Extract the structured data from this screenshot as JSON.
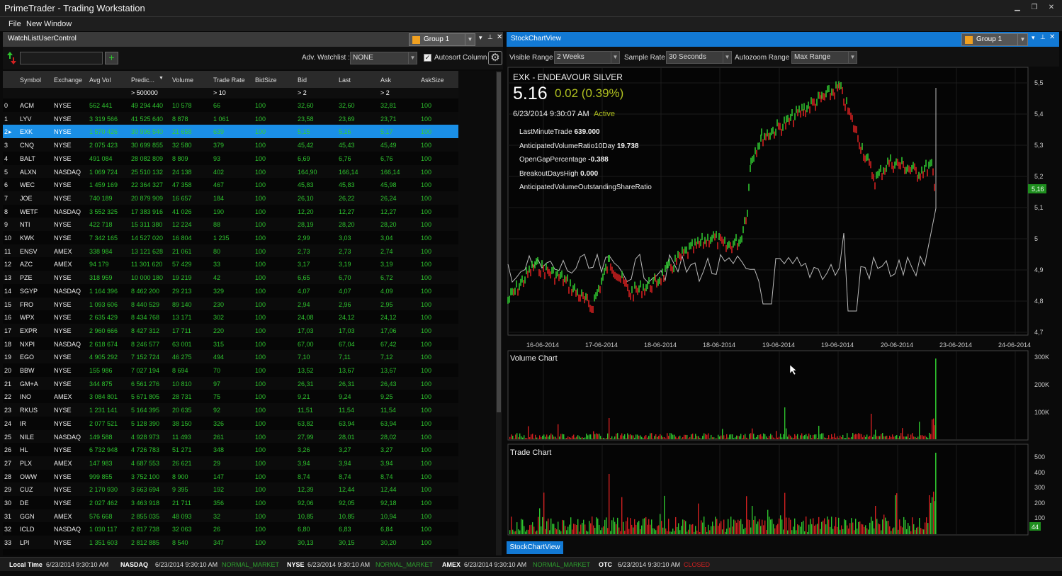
{
  "window": {
    "title": "PrimeTrader - Trading Workstation"
  },
  "menu": {
    "file": "File",
    "new_window": "New Window"
  },
  "watchlist": {
    "panel_title": "WatchListUserControl",
    "group": "Group 1",
    "adv_label": "Adv. Watchlist :",
    "adv_value": "NONE",
    "autosort_label": "Autosort Column",
    "columns": [
      "Symbol",
      "Exchange",
      "Avg Vol",
      "Predic...",
      "Volume",
      "Trade Rate",
      "BidSize",
      "Bid",
      "Last",
      "Ask",
      "AskSize"
    ],
    "filters": {
      "predic": "> 500000",
      "trade_rate": "> 10",
      "bid": "> 2",
      "ask": "> 2"
    },
    "rows": [
      [
        "0",
        "ACM",
        "NYSE",
        "562 441",
        "49 294 440",
        "10 578",
        "66",
        "100",
        "32,60",
        "32,60",
        "32,81",
        "100"
      ],
      [
        "1",
        "LYV",
        "NYSE",
        "3 319 566",
        "41 525 640",
        "8 878",
        "1 061",
        "100",
        "23,58",
        "23,69",
        "23,71",
        "100"
      ],
      [
        "2",
        "EXK",
        "NYSE",
        "1 570 426",
        "30 996 540",
        "21 658",
        "639",
        "100",
        "5,15",
        "5,16",
        "5,17",
        "100"
      ],
      [
        "3",
        "CNQ",
        "NYSE",
        "2 075 423",
        "30 699 855",
        "32 580",
        "379",
        "100",
        "45,42",
        "45,43",
        "45,49",
        "100"
      ],
      [
        "4",
        "BALT",
        "NYSE",
        "491 084",
        "28 082 809",
        "8 809",
        "93",
        "100",
        "6,69",
        "6,76",
        "6,76",
        "100"
      ],
      [
        "5",
        "ALXN",
        "NASDAQ",
        "1 069 724",
        "25 510 132",
        "24 138",
        "402",
        "100",
        "164,90",
        "166,14",
        "166,14",
        "100"
      ],
      [
        "6",
        "WEC",
        "NYSE",
        "1 459 169",
        "22 364 327",
        "47 358",
        "467",
        "100",
        "45,83",
        "45,83",
        "45,98",
        "100"
      ],
      [
        "7",
        "JOE",
        "NYSE",
        "740 189",
        "20 879 909",
        "16 657",
        "184",
        "100",
        "26,10",
        "26,22",
        "26,24",
        "100"
      ],
      [
        "8",
        "WETF",
        "NASDAQ",
        "3 552 325",
        "17 383 916",
        "41 026",
        "190",
        "100",
        "12,20",
        "12,27",
        "12,27",
        "100"
      ],
      [
        "9",
        "NTI",
        "NYSE",
        "422 718",
        "15 311 380",
        "12 224",
        "88",
        "100",
        "28,19",
        "28,20",
        "28,20",
        "100"
      ],
      [
        "10",
        "KWK",
        "NYSE",
        "7 342 165",
        "14 527 020",
        "16 804",
        "1 235",
        "100",
        "2,99",
        "3,03",
        "3,04",
        "100"
      ],
      [
        "11",
        "ENSV",
        "AMEX",
        "338 984",
        "13 121 628",
        "21 061",
        "80",
        "100",
        "2,73",
        "2,73",
        "2,74",
        "100"
      ],
      [
        "12",
        "AZC",
        "AMEX",
        "94 179",
        "11 301 620",
        "57 429",
        "33",
        "100",
        "3,17",
        "3,19",
        "3,19",
        "100"
      ],
      [
        "13",
        "PZE",
        "NYSE",
        "318 959",
        "10 000 180",
        "19 219",
        "42",
        "100",
        "6,65",
        "6,70",
        "6,72",
        "100"
      ],
      [
        "14",
        "SGYP",
        "NASDAQ",
        "1 164 396",
        "8 462 200",
        "29 213",
        "329",
        "100",
        "4,07",
        "4,07",
        "4,09",
        "100"
      ],
      [
        "15",
        "FRO",
        "NYSE",
        "1 093 606",
        "8 440 529",
        "89 140",
        "230",
        "100",
        "2,94",
        "2,96",
        "2,95",
        "100"
      ],
      [
        "16",
        "WPX",
        "NYSE",
        "2 635 429",
        "8 434 768",
        "13 171",
        "302",
        "100",
        "24,08",
        "24,12",
        "24,12",
        "100"
      ],
      [
        "17",
        "EXPR",
        "NYSE",
        "2 960 666",
        "8 427 312",
        "17 711",
        "220",
        "100",
        "17,03",
        "17,03",
        "17,06",
        "100"
      ],
      [
        "18",
        "NXPI",
        "NASDAQ",
        "2 618 674",
        "8 246 577",
        "63 001",
        "315",
        "100",
        "67,00",
        "67,04",
        "67,42",
        "100"
      ],
      [
        "19",
        "EGO",
        "NYSE",
        "4 905 292",
        "7 152 724",
        "46 275",
        "494",
        "100",
        "7,10",
        "7,11",
        "7,12",
        "100"
      ],
      [
        "20",
        "BBW",
        "NYSE",
        "155 986",
        "7 027 194",
        "8 694",
        "70",
        "100",
        "13,52",
        "13,67",
        "13,67",
        "100"
      ],
      [
        "21",
        "GM+A",
        "NYSE",
        "344 875",
        "6 561 276",
        "10 810",
        "97",
        "100",
        "26,31",
        "26,31",
        "26,43",
        "100"
      ],
      [
        "22",
        "INO",
        "AMEX",
        "3 084 801",
        "5 671 805",
        "28 731",
        "75",
        "100",
        "9,21",
        "9,24",
        "9,25",
        "100"
      ],
      [
        "23",
        "RKUS",
        "NYSE",
        "1 231 141",
        "5 164 395",
        "20 635",
        "92",
        "100",
        "11,51",
        "11,54",
        "11,54",
        "100"
      ],
      [
        "24",
        "IR",
        "NYSE",
        "2 077 521",
        "5 128 390",
        "38 150",
        "326",
        "100",
        "63,82",
        "63,94",
        "63,94",
        "100"
      ],
      [
        "25",
        "NILE",
        "NASDAQ",
        "149 588",
        "4 928 973",
        "11 493",
        "261",
        "100",
        "27,99",
        "28,01",
        "28,02",
        "100"
      ],
      [
        "26",
        "HL",
        "NYSE",
        "6 732 948",
        "4 726 783",
        "51 271",
        "348",
        "100",
        "3,26",
        "3,27",
        "3,27",
        "100"
      ],
      [
        "27",
        "PLX",
        "AMEX",
        "147 983",
        "4 687 553",
        "26 621",
        "29",
        "100",
        "3,94",
        "3,94",
        "3,94",
        "100"
      ],
      [
        "28",
        "OWW",
        "NYSE",
        "999 855",
        "3 752 100",
        "8 900",
        "147",
        "100",
        "8,74",
        "8,74",
        "8,74",
        "100"
      ],
      [
        "29",
        "CUZ",
        "NYSE",
        "2 170 930",
        "3 663 694",
        "9 395",
        "192",
        "100",
        "12,39",
        "12,44",
        "12,44",
        "100"
      ],
      [
        "30",
        "DE",
        "NYSE",
        "2 027 462",
        "3 463 918",
        "21 711",
        "356",
        "100",
        "92,06",
        "92,05",
        "92,18",
        "100"
      ],
      [
        "31",
        "GGN",
        "AMEX",
        "576 668",
        "2 855 035",
        "48 093",
        "32",
        "100",
        "10,85",
        "10,85",
        "10,94",
        "100"
      ],
      [
        "32",
        "ICLD",
        "NASDAQ",
        "1 030 117",
        "2 817 738",
        "32 063",
        "26",
        "100",
        "6,80",
        "6,83",
        "6,84",
        "100"
      ],
      [
        "33",
        "LPI",
        "NYSE",
        "1 351 603",
        "2 812 885",
        "8 540",
        "347",
        "100",
        "30,13",
        "30,15",
        "30,20",
        "100"
      ]
    ]
  },
  "chart": {
    "panel_title": "StockChartView",
    "group": "Group 1",
    "visible_range_label": "Visible Range :",
    "visible_range_value": "2 Weeks",
    "sample_rate_label": "Sample Rate :",
    "sample_rate_value": "30 Seconds",
    "autozoom_label": "Autozoom Range :",
    "autozoom_value": "Max Range",
    "symbol_title": "EXK - ENDEAVOUR SILVER",
    "price": "5.16",
    "change": "0.02 (0.39%)",
    "timestamp": "6/23/2014 9:30:07 AM",
    "status": "Active",
    "stats": [
      {
        "label": "LastMinuteTrade",
        "value": "639.000"
      },
      {
        "label": "AnticipatedVolumeRatio10Day",
        "value": "19.738"
      },
      {
        "label": "OpenGapPercentage",
        "value": "-0.388"
      },
      {
        "label": "BreakoutDaysHigh",
        "value": "0.000"
      },
      {
        "label": "AnticipatedVolumeOutstandingShareRatio",
        "value": ""
      }
    ],
    "price_axis": [
      "5,5",
      "5,4",
      "5,3",
      "5,2",
      "5,1",
      "5",
      "4,9",
      "4,8",
      "4,7"
    ],
    "price_tag": "5,16",
    "date_axis": [
      "16-06-2014",
      "17-06-2014",
      "18-06-2014",
      "18-06-2014",
      "19-06-2014",
      "19-06-2014",
      "20-06-2014",
      "23-06-2014",
      "24-06-2014"
    ],
    "volume_title": "Volume Chart",
    "volume_axis": [
      "300K",
      "200K",
      "100K"
    ],
    "trade_title": "Trade Chart",
    "trade_axis": [
      "500",
      "400",
      "300",
      "200",
      "100"
    ],
    "trade_tag": "44",
    "tab_label": "StockChartView",
    "colors": {
      "up": "#2ec22e",
      "down": "#d02020",
      "accent": "#1279d4"
    }
  },
  "status": {
    "local_label": "Local Time",
    "local_time": "6/23/2014 9:30:10 AM",
    "nasdaq_label": "NASDAQ",
    "nasdaq_time": "6/23/2014 9:30:10 AM",
    "nasdaq_state": "NORMAL_MARKET",
    "nyse_label": "NYSE",
    "nyse_time": "6/23/2014 9:30:10 AM",
    "nyse_state": "NORMAL_MARKET",
    "amex_label": "AMEX",
    "amex_time": "6/23/2014 9:30:10 AM",
    "amex_state": "NORMAL_MARKET",
    "otc_label": "OTC",
    "otc_time": "6/23/2014 9:30:10 AM",
    "otc_state": "CLOSED"
  }
}
